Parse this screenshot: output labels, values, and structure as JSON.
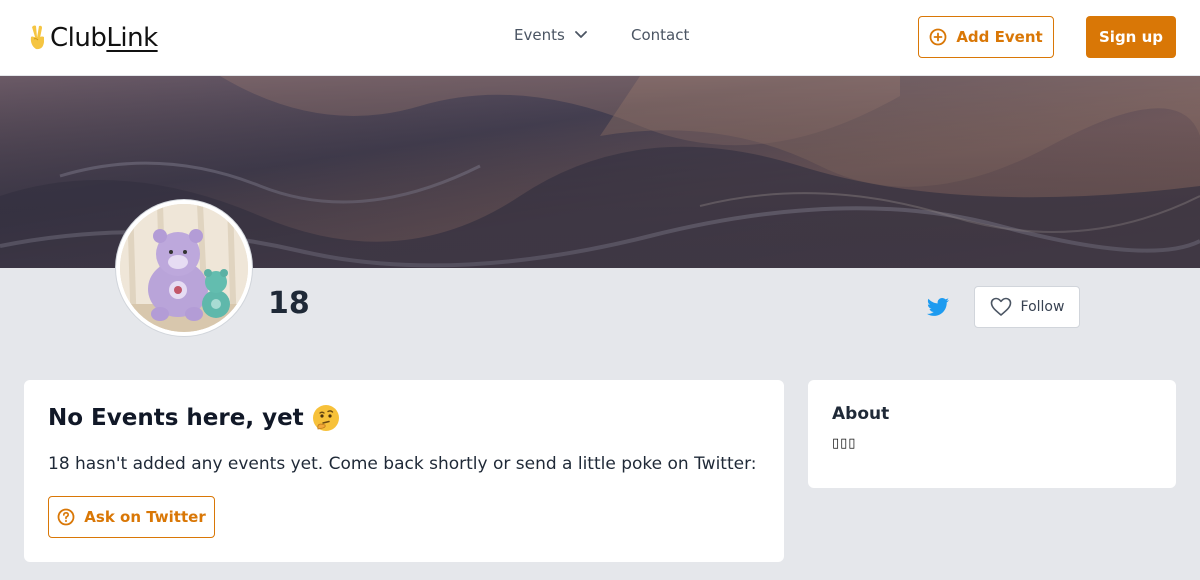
{
  "header": {
    "logo": {
      "part1": "Club",
      "part2": "Link",
      "icon": "victory-hand-icon"
    },
    "nav": {
      "events_label": "Events",
      "contact_label": "Contact"
    },
    "add_event_label": "Add Event",
    "signup_label": "Sign up"
  },
  "profile": {
    "name": "18",
    "follow_label": "Follow"
  },
  "main_card": {
    "title": "No Events here, yet",
    "title_emoji": "thinking-face-icon",
    "message": "18 hasn't added any events yet. Come back shortly or send a little poke on Twitter:",
    "ask_label": "Ask on Twitter"
  },
  "about_card": {
    "title": "About",
    "text": "▯▯▯"
  },
  "colors": {
    "accent": "#d97706",
    "twitter": "#1d9bf0",
    "page_bg": "#e5e7eb"
  }
}
